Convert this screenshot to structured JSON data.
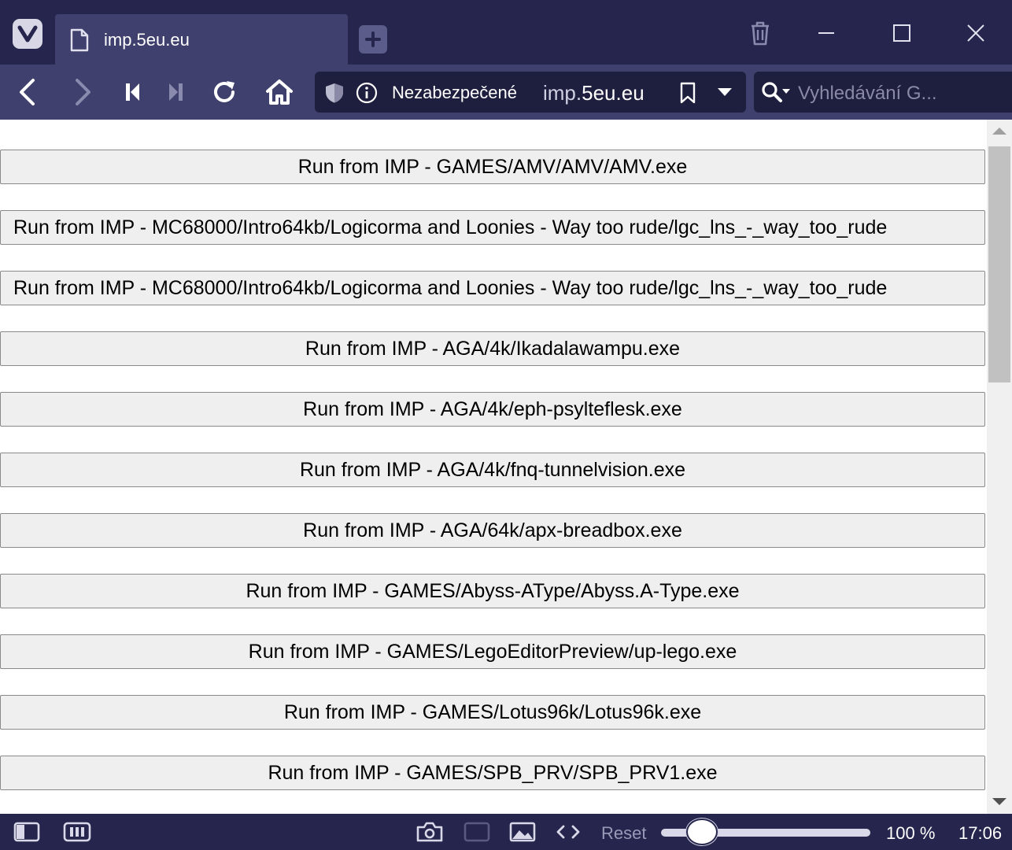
{
  "browser": {
    "tab": {
      "title": "imp.5eu.eu"
    },
    "address_bar": {
      "security_label": "Nezabezpečené",
      "url_prefix": "imp.",
      "url_host": "5eu.eu"
    },
    "search": {
      "placeholder": "Vyhledávání G..."
    },
    "accent_color": "#25254d"
  },
  "page": {
    "buttons": [
      "Run from IMP - GAMES/AMV/AMV/AMV.exe",
      "Run from IMP - MC68000/Intro64kb/Logicorma and Loonies - Way too rude/lgc_lns_-_way_too_rude",
      "Run from IMP - MC68000/Intro64kb/Logicorma and Loonies - Way too rude/lgc_lns_-_way_too_rude",
      "Run from IMP - AGA/4k/Ikadalawampu.exe",
      "Run from IMP - AGA/4k/eph-psylteflesk.exe",
      "Run from IMP - AGA/4k/fnq-tunnelvision.exe",
      "Run from IMP - AGA/64k/apx-breadbox.exe",
      "Run from IMP - GAMES/Abyss-AType/Abyss.A-Type.exe",
      "Run from IMP - GAMES/LegoEditorPreview/up-lego.exe",
      "Run from IMP - GAMES/Lotus96k/Lotus96k.exe",
      "Run from IMP - GAMES/SPB_PRV/SPB_PRV1.exe"
    ]
  },
  "statusbar": {
    "reset_label": "Reset",
    "zoom": "100 %",
    "zoom_level": 0.2,
    "clock": "17:06"
  }
}
